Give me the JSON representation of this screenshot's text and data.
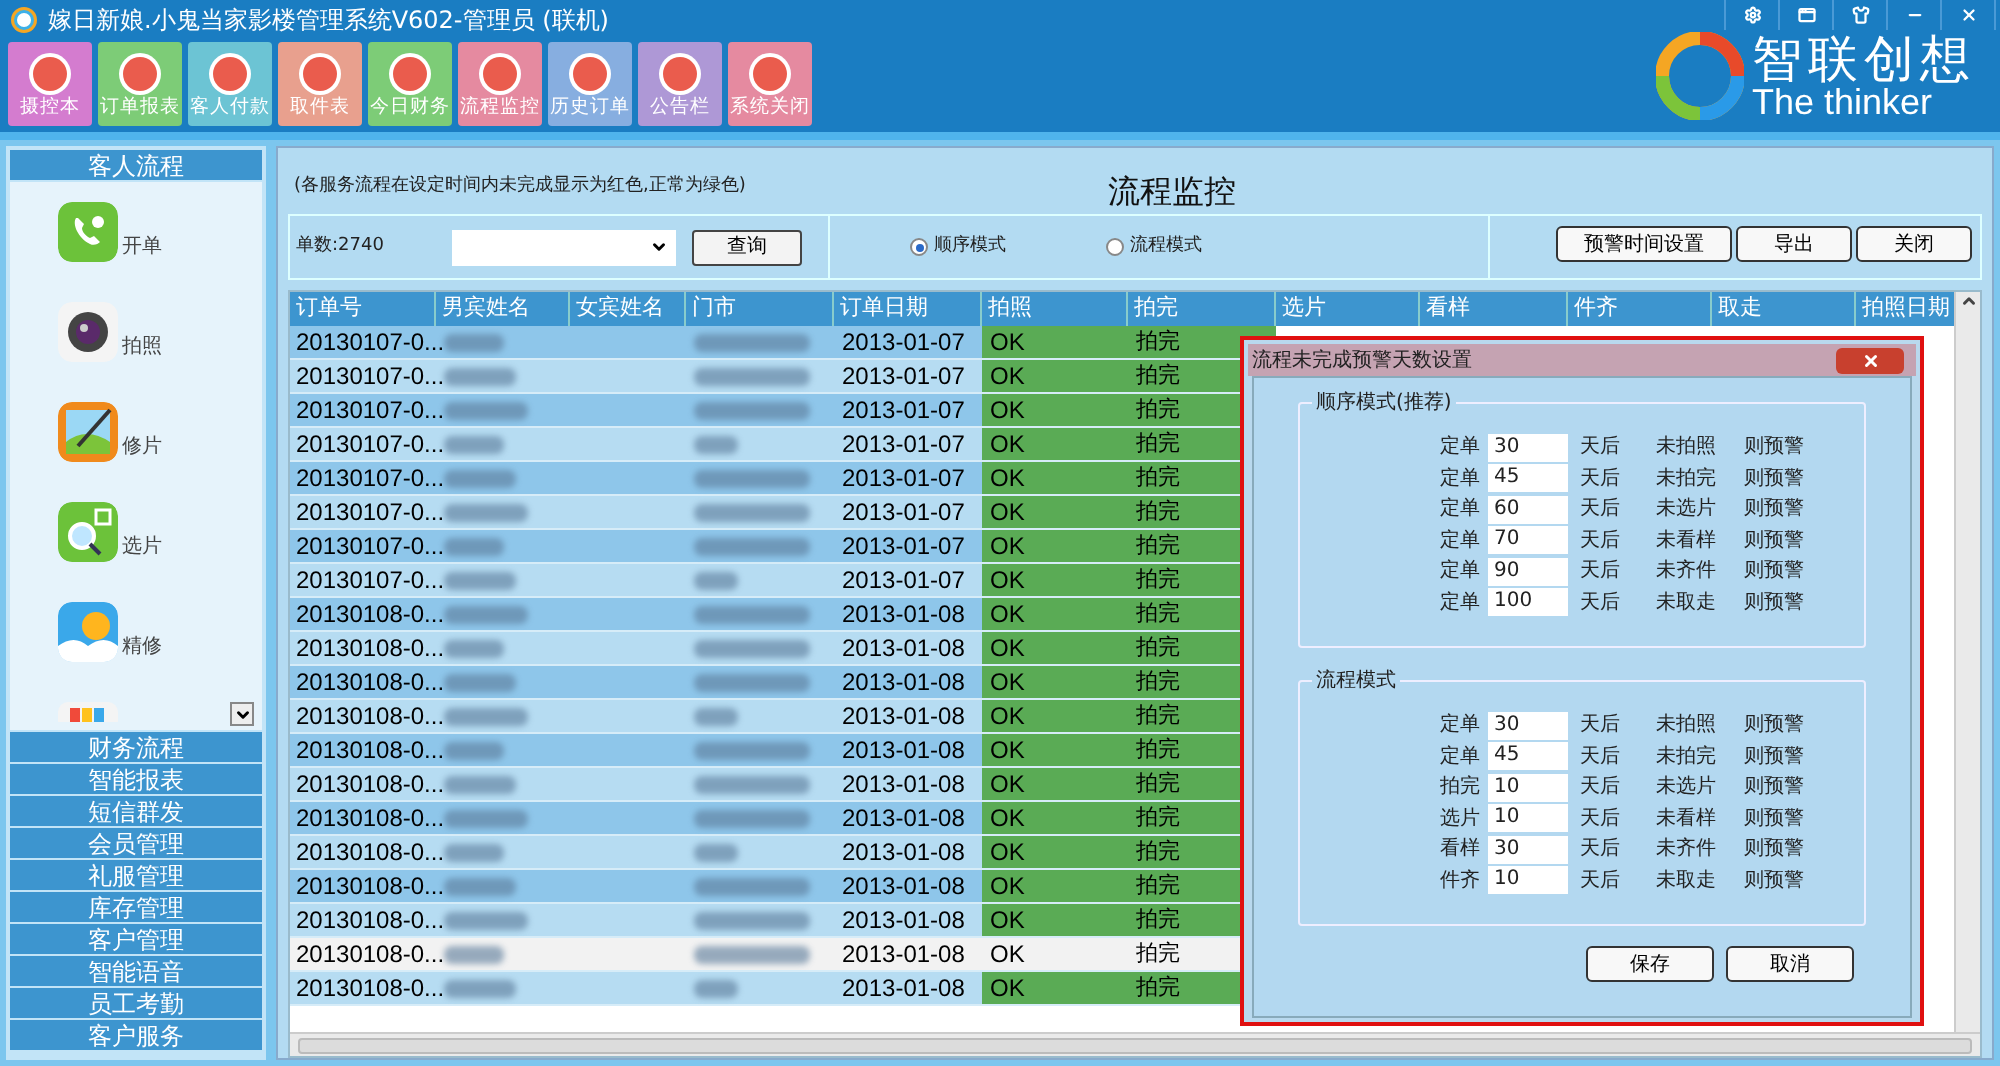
{
  "window": {
    "title": "嫁日新娘.小鬼当家影楼管理系统V602-管理员 (联机)"
  },
  "toolbar": [
    {
      "label": "摄控本",
      "color": "#d47ccf"
    },
    {
      "label": "订单报表",
      "color": "#7dcc77"
    },
    {
      "label": "客人付款",
      "color": "#6cc4d4"
    },
    {
      "label": "取件表",
      "color": "#e8a08e"
    },
    {
      "label": "今日财务",
      "color": "#7dcc77"
    },
    {
      "label": "流程监控",
      "color": "#e58aa0"
    },
    {
      "label": "历史订单",
      "color": "#87aee0"
    },
    {
      "label": "公告栏",
      "color": "#ae98d6"
    },
    {
      "label": "系统关闭",
      "color": "#e58aa0"
    }
  ],
  "logo": {
    "name": "智联创想",
    "tagline": "The thinker"
  },
  "sidebar": {
    "header": "客人流程",
    "apps": [
      {
        "label": "开单",
        "kind": "phone"
      },
      {
        "label": "拍照",
        "kind": "camera"
      },
      {
        "label": "修片",
        "kind": "picture"
      },
      {
        "label": "选片",
        "kind": "search"
      },
      {
        "label": "精修",
        "kind": "sun"
      },
      {
        "kind": "book"
      }
    ],
    "menu": [
      "财务流程",
      "智能报表",
      "短信群发",
      "会员管理",
      "礼服管理",
      "库存管理",
      "客户管理",
      "智能语音",
      "员工考勤",
      "客户服务"
    ]
  },
  "main": {
    "note": "(各服务流程在设定时间内未完成显示为红色,正常为绿色)",
    "title": "流程监控",
    "count": "单数:2740",
    "search_button": "查询",
    "modes": [
      {
        "label": "顺序模式",
        "selected": true
      },
      {
        "label": "流程模式",
        "selected": false
      }
    ],
    "buttons": [
      "预警时间设置",
      "导出",
      "关闭"
    ],
    "table": {
      "columns": [
        "订单号",
        "男宾姓名",
        "女宾姓名",
        "门市",
        "订单日期",
        "拍照",
        "拍完",
        "选片",
        "看样",
        "件齐",
        "取走",
        "拍照日期"
      ],
      "rows": [
        {
          "order": "20130107-0...",
          "date": "2013-01-07",
          "photo": "OK",
          "shot": "拍完",
          "selected": false
        },
        {
          "order": "20130107-0...",
          "date": "2013-01-07",
          "photo": "OK",
          "shot": "拍完",
          "selected": false
        },
        {
          "order": "20130107-0...",
          "date": "2013-01-07",
          "photo": "OK",
          "shot": "拍完",
          "selected": false
        },
        {
          "order": "20130107-0...",
          "date": "2013-01-07",
          "photo": "OK",
          "shot": "拍完",
          "selected": false
        },
        {
          "order": "20130107-0...",
          "date": "2013-01-07",
          "photo": "OK",
          "shot": "拍完",
          "selected": false
        },
        {
          "order": "20130107-0...",
          "date": "2013-01-07",
          "photo": "OK",
          "shot": "拍完",
          "selected": false
        },
        {
          "order": "20130107-0...",
          "date": "2013-01-07",
          "photo": "OK",
          "shot": "拍完",
          "selected": false
        },
        {
          "order": "20130107-0...",
          "date": "2013-01-07",
          "photo": "OK",
          "shot": "拍完",
          "selected": false
        },
        {
          "order": "20130108-0...",
          "date": "2013-01-08",
          "photo": "OK",
          "shot": "拍完",
          "selected": false
        },
        {
          "order": "20130108-0...",
          "date": "2013-01-08",
          "photo": "OK",
          "shot": "拍完",
          "selected": false
        },
        {
          "order": "20130108-0...",
          "date": "2013-01-08",
          "photo": "OK",
          "shot": "拍完",
          "selected": false
        },
        {
          "order": "20130108-0...",
          "date": "2013-01-08",
          "photo": "OK",
          "shot": "拍完",
          "selected": false
        },
        {
          "order": "20130108-0...",
          "date": "2013-01-08",
          "photo": "OK",
          "shot": "拍完",
          "selected": false
        },
        {
          "order": "20130108-0...",
          "date": "2013-01-08",
          "photo": "OK",
          "shot": "拍完",
          "selected": false
        },
        {
          "order": "20130108-0...",
          "date": "2013-01-08",
          "photo": "OK",
          "shot": "拍完",
          "selected": false
        },
        {
          "order": "20130108-0...",
          "date": "2013-01-08",
          "photo": "OK",
          "shot": "拍完",
          "selected": false
        },
        {
          "order": "20130108-0...",
          "date": "2013-01-08",
          "photo": "OK",
          "shot": "拍完",
          "selected": false
        },
        {
          "order": "20130108-0...",
          "date": "2013-01-08",
          "photo": "OK",
          "shot": "拍完",
          "selected": false
        },
        {
          "order": "20130108-0...",
          "date": "2013-01-08",
          "photo": "OK",
          "shot": "拍完",
          "selected": true
        },
        {
          "order": "20130108-0...",
          "date": "2013-01-08",
          "photo": "OK",
          "shot": "拍完",
          "selected": false
        }
      ]
    }
  },
  "dialog": {
    "title": "流程未完成预警天数设置",
    "groups": [
      {
        "title": "顺序模式(推荐)",
        "rows": [
          {
            "from": "定单",
            "value": "30",
            "unit": "天后",
            "missing": "未拍照",
            "action": "则预警"
          },
          {
            "from": "定单",
            "value": "45",
            "unit": "天后",
            "missing": "未拍完",
            "action": "则预警"
          },
          {
            "from": "定单",
            "value": "60",
            "unit": "天后",
            "missing": "未选片",
            "action": "则预警"
          },
          {
            "from": "定单",
            "value": "70",
            "unit": "天后",
            "missing": "未看样",
            "action": "则预警"
          },
          {
            "from": "定单",
            "value": "90",
            "unit": "天后",
            "missing": "未齐件",
            "action": "则预警"
          },
          {
            "from": "定单",
            "value": "100",
            "unit": "天后",
            "missing": "未取走",
            "action": "则预警"
          }
        ]
      },
      {
        "title": "流程模式",
        "rows": [
          {
            "from": "定单",
            "value": "30",
            "unit": "天后",
            "missing": "未拍照",
            "action": "则预警"
          },
          {
            "from": "定单",
            "value": "45",
            "unit": "天后",
            "missing": "未拍完",
            "action": "则预警"
          },
          {
            "from": "拍完",
            "value": "10",
            "unit": "天后",
            "missing": "未选片",
            "action": "则预警"
          },
          {
            "from": "选片",
            "value": "10",
            "unit": "天后",
            "missing": "未看样",
            "action": "则预警"
          },
          {
            "from": "看样",
            "value": "30",
            "unit": "天后",
            "missing": "未齐件",
            "action": "则预警"
          },
          {
            "from": "件齐",
            "value": "10",
            "unit": "天后",
            "missing": "未取走",
            "action": "则预警"
          }
        ]
      }
    ],
    "buttons": [
      "保存",
      "取消"
    ]
  }
}
